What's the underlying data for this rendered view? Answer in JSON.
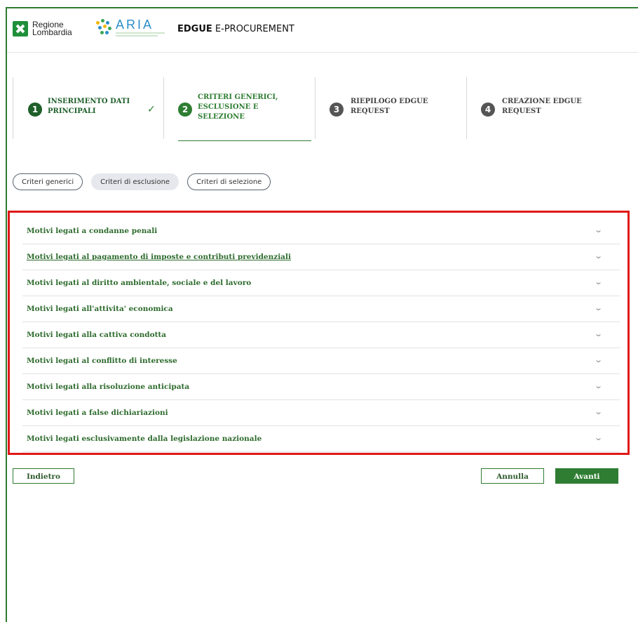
{
  "header": {
    "logo_rl_line1": "Regione",
    "logo_rl_line2": "Lombardia",
    "logo_aria": "ARIA",
    "app_title_bold": "EDGUE",
    "app_title_rest": " E-PROCUREMENT"
  },
  "steps": [
    {
      "num": "1",
      "label_l1": "INSERIMENTO DATI",
      "label_l2": "PRINCIPALI",
      "label_l3": "",
      "state": "done",
      "color": "#1f5f2a"
    },
    {
      "num": "2",
      "label_l1": "CRITERI GENERICI,",
      "label_l2": "ESCLUSIONE E",
      "label_l3": "SELEZIONE",
      "state": "active",
      "color": "#2e7d32"
    },
    {
      "num": "3",
      "label_l1": "RIEPILOGO EDGUE",
      "label_l2": "REQUEST",
      "label_l3": "",
      "state": "todo",
      "color": "#555555"
    },
    {
      "num": "4",
      "label_l1": "CREAZIONE EDGUE",
      "label_l2": "REQUEST",
      "label_l3": "",
      "state": "todo",
      "color": "#555555"
    }
  ],
  "chips": [
    {
      "label": "Criteri generici",
      "selected": false
    },
    {
      "label": "Criteri di esclusione",
      "selected": true
    },
    {
      "label": "Criteri di selezione",
      "selected": false
    }
  ],
  "accordion": [
    {
      "label": "Motivi legati a condanne penali"
    },
    {
      "label": "Motivi legati al pagamento di imposte e contributi previdenziali",
      "underlined": true
    },
    {
      "label": "Motivi legati al diritto ambientale, sociale e del lavoro"
    },
    {
      "label": "Motivi legati all'attivita' economica"
    },
    {
      "label": "Motivi legati alla cattiva condotta"
    },
    {
      "label": "Motivi legati al conflitto di interesse"
    },
    {
      "label": "Motivi legati alla risoluzione anticipata"
    },
    {
      "label": "Motivi legati a false dichiariazioni"
    },
    {
      "label": "Motivi legati esclusivamente dalla legislazione nazionale"
    }
  ],
  "buttons": {
    "back": "Indietro",
    "cancel": "Annulla",
    "next": "Avanti"
  },
  "icons": {
    "check": "✓",
    "chevron": "⌄"
  },
  "colors": {
    "brand_green": "#2e7d32",
    "highlight_red": "#e01818"
  }
}
